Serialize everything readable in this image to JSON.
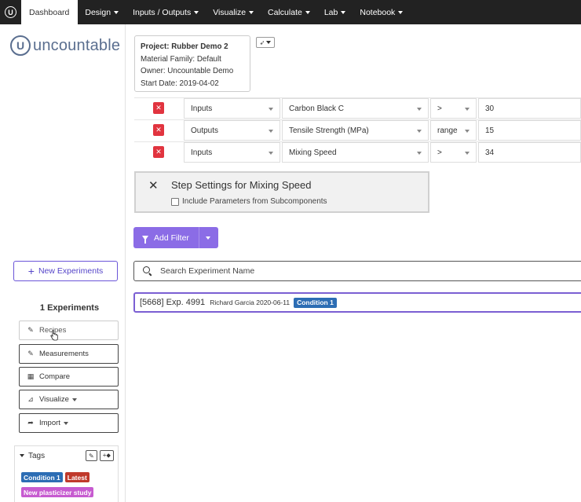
{
  "nav": {
    "logo": "U",
    "items": [
      {
        "label": "Dashboard",
        "active": true,
        "dropdown": false
      },
      {
        "label": "Design",
        "active": false,
        "dropdown": true
      },
      {
        "label": "Inputs / Outputs",
        "active": false,
        "dropdown": true
      },
      {
        "label": "Visualize",
        "active": false,
        "dropdown": true
      },
      {
        "label": "Calculate",
        "active": false,
        "dropdown": true
      },
      {
        "label": "Lab",
        "active": false,
        "dropdown": true
      },
      {
        "label": "Notebook",
        "active": false,
        "dropdown": true
      }
    ]
  },
  "brand": {
    "mark": "U",
    "name": "uncountable",
    "color": "#5a6e8f"
  },
  "project": {
    "name": "Project: Rubber Demo 2",
    "family": "Material Family: Default",
    "owner": "Owner: Uncountable Demo",
    "start": "Start Date: 2019-04-02"
  },
  "filters": [
    {
      "category": "Inputs",
      "field": "Carbon Black C",
      "operator": ">",
      "value": "30"
    },
    {
      "category": "Outputs",
      "field": "Tensile Strength (MPa)",
      "operator": "range",
      "value": "15"
    },
    {
      "category": "Inputs",
      "field": "Mixing Speed",
      "operator": ">",
      "value": "34"
    }
  ],
  "step_settings": {
    "title": "Step Settings for Mixing Speed",
    "checkbox_label": "Include Parameters from Subcomponents",
    "checked": false
  },
  "add_filter": {
    "label": "Add Filter",
    "color": "#8b6ce6"
  },
  "search": {
    "placeholder": "Search Experiment Name"
  },
  "experiment": {
    "id": "[5668] Exp. 4991",
    "meta": "Richard Garcia 2020-06-11",
    "tag": "Condition 1"
  },
  "sidebar": {
    "new_experiments": "New Experiments",
    "count": "1 Experiments",
    "buttons": [
      {
        "icon": "pencil-icon",
        "glyph": "✎",
        "label": "Recipes"
      },
      {
        "icon": "pencil-icon",
        "glyph": "✎",
        "label": "Measurements"
      },
      {
        "icon": "grid-icon",
        "glyph": "▦",
        "label": "Compare"
      },
      {
        "icon": "chart-icon",
        "glyph": "⊿",
        "label": "Visualize"
      },
      {
        "icon": "share-icon",
        "glyph": "➦",
        "label": "Import"
      }
    ],
    "tags_title": "Tags",
    "tags": [
      {
        "label": "Condition 1",
        "color": "#2c6db4"
      },
      {
        "label": "Latest",
        "color": "#c0392b"
      },
      {
        "label": "New plasticizer study",
        "color": "#c75bd0"
      }
    ]
  }
}
